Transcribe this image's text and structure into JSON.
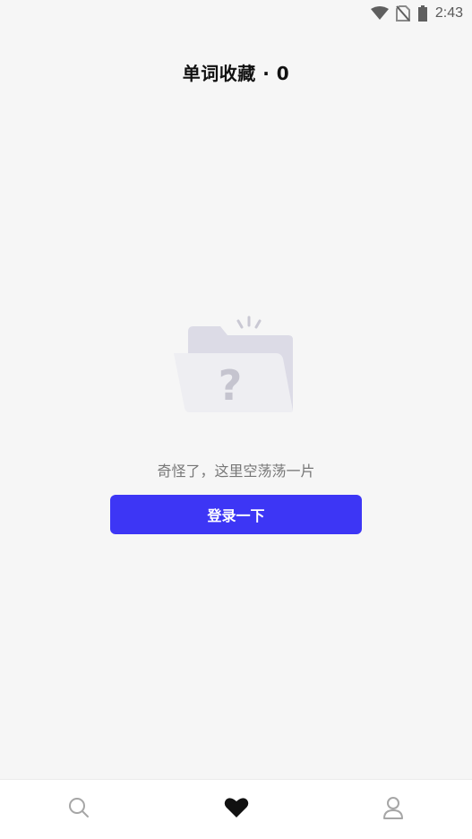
{
  "status_bar": {
    "time": "2:43",
    "icons": [
      "wifi-icon",
      "no-sim-icon",
      "battery-icon"
    ]
  },
  "header": {
    "title": "单词收藏 · 0"
  },
  "empty_state": {
    "icon": "empty-folder-question-icon",
    "message": "奇怪了，这里空荡荡一片",
    "button_label": "登录一下"
  },
  "tabs": [
    {
      "icon": "search-icon",
      "active": false
    },
    {
      "icon": "heart-icon",
      "active": true
    },
    {
      "icon": "user-icon",
      "active": false
    }
  ],
  "colors": {
    "accent": "#3d36f5",
    "background": "#f6f6f6",
    "tab_inactive": "#a6a6a6",
    "tab_active": "#111111"
  }
}
